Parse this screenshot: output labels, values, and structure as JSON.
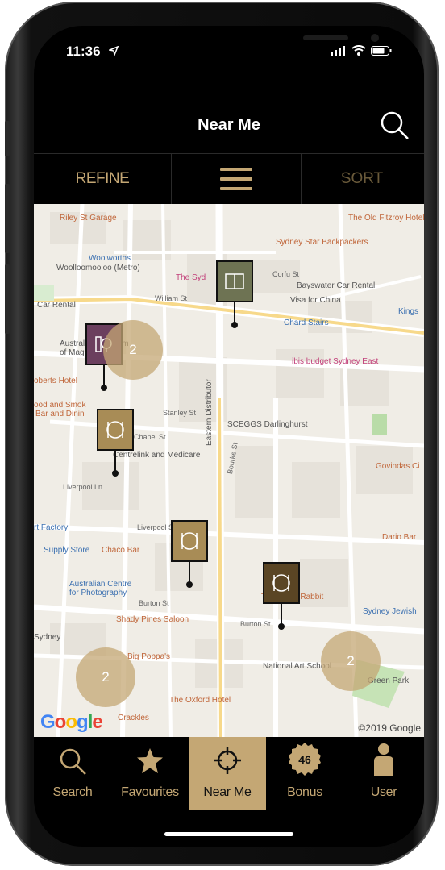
{
  "status_bar": {
    "time": "11:36"
  },
  "header": {
    "title": "Near Me"
  },
  "toolbar": {
    "refine_label": "REFINE",
    "sort_label": "SORT"
  },
  "map": {
    "labels": {
      "riley": "Riley St Garage",
      "woolworths1": "Woolworths",
      "woolworths2": "Woolloomooloo (Metro)",
      "sydney_star": "Sydney Star Backpackers",
      "old_fitzroy": "The Old Fitzroy Hotel",
      "the_syd": "The Syd",
      "corfu": "Corfu St",
      "bayswater": "Bayswater Car Rental",
      "visa": "Visa for China",
      "kings": "Kings",
      "car_rental": "Car Rental",
      "william": "William St",
      "chard": "Chard Stairs",
      "australian_museum1": "Australian Museum",
      "australian_museum2": "of Magical Arts",
      "ibis": "ibis budget Sydney East",
      "roberts": "oberts Hotel",
      "food_smoke1": "ood and Smok",
      "food_smoke2": "Bar and Dinin",
      "stanley": "Stanley St",
      "sceggs": "SCEGGS Darlinghurst",
      "chapel": "Chapel St",
      "centrelink": "Centrelink and Medicare",
      "eastern": "Eastern Distributor",
      "bourke": "Bourke St",
      "govindas": "Govindas Ci",
      "liverpool_ln": "Liverpool Ln",
      "liverpool_st": "Liverpool St",
      "art_factory": "rt Factory",
      "supply": "Supply Store",
      "chaco": "Chaco Bar",
      "dario": "Dario Bar",
      "acp1": "Australian Centre",
      "acp2": "for Photography",
      "burton": "Burton St",
      "rusty": "The Rusty Rabbit",
      "shady": "Shady Pines Saloon",
      "sydney_jewish": "Sydney Jewish",
      "sydney": "Sydney",
      "big_poppas": "Big Poppa's",
      "nas": "National Art School",
      "oxford": "The Oxford Hotel",
      "green_park": "Green Park",
      "crackles": "Crackles"
    },
    "clusters": [
      "2",
      "2",
      "2"
    ],
    "google_logo": "Google",
    "copyright": "©2019 Google"
  },
  "tabs": [
    {
      "label": "Search"
    },
    {
      "label": "Favourites"
    },
    {
      "label": "Near Me"
    },
    {
      "label": "Bonus",
      "badge": "46"
    },
    {
      "label": "User"
    }
  ],
  "colors": {
    "gold": "#c4a774",
    "pin_purple": "#6b3f5e",
    "pin_olive": "#6e7353",
    "pin_gold": "#a88c56",
    "pin_dark": "#5a4524"
  }
}
